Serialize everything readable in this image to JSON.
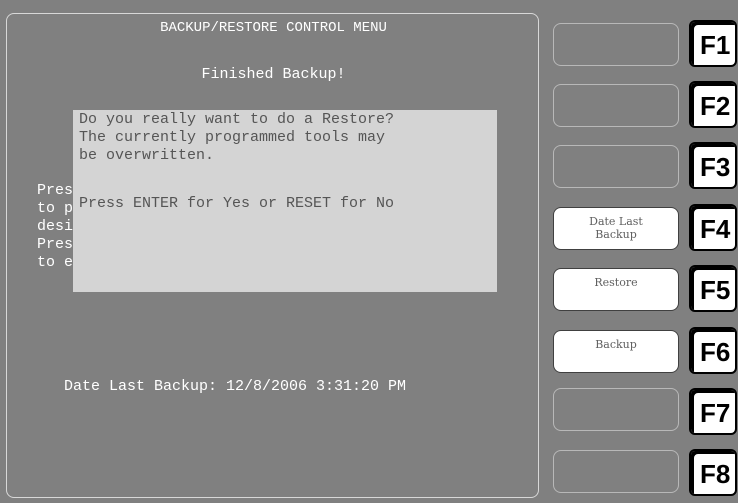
{
  "main": {
    "title": "BACKUP/RESTORE CONTROL MENU",
    "status": "Finished Backup!",
    "background_lines": [
      "Pres",
      "to p",
      "desi",
      "Pres",
      "to e"
    ],
    "date_line": "Date Last Backup: 12/8/2006 3:31:20 PM"
  },
  "dialog": {
    "lines": [
      "Do you really want to do a Restore?",
      "The currently programmed tools may",
      "be overwritten.",
      "",
      "Press ENTER for Yes or RESET for No"
    ]
  },
  "side_buttons": [
    {
      "label": ""
    },
    {
      "label": ""
    },
    {
      "label": ""
    },
    {
      "label": "Date Last\nBackup"
    },
    {
      "label": "Restore"
    },
    {
      "label": "Backup"
    },
    {
      "label": ""
    },
    {
      "label": ""
    }
  ],
  "function_keys": [
    "F1",
    "F2",
    "F3",
    "F4",
    "F5",
    "F6",
    "F7",
    "F8"
  ]
}
